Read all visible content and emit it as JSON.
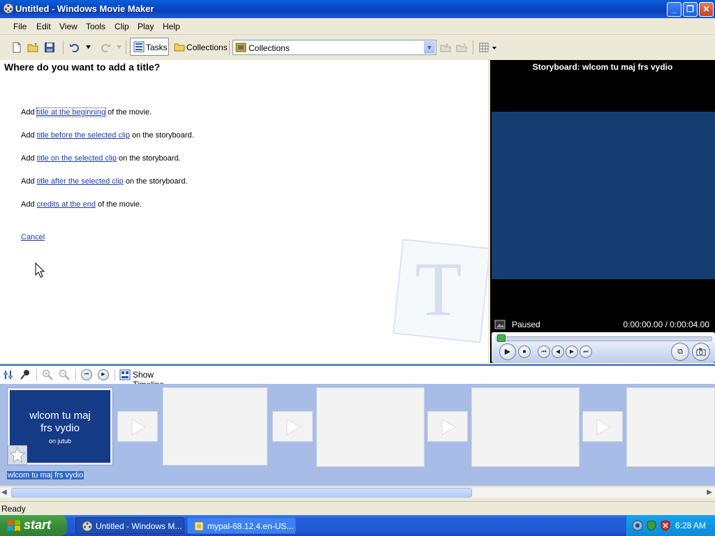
{
  "window": {
    "title": "Untitled - Windows Movie Maker",
    "buttons": {
      "minimize": "_",
      "maximize": "❐",
      "close": "✕"
    }
  },
  "menu": [
    "File",
    "Edit",
    "View",
    "Tools",
    "Clip",
    "Play",
    "Help"
  ],
  "toolbar": {
    "tasks_label": "Tasks",
    "collections_label": "Collections",
    "collections_dropdown_value": "Collections"
  },
  "task_pane": {
    "heading": "Where do you want to add a title?",
    "options": [
      {
        "prefix": "Add ",
        "link": "title at the beginning",
        "suffix": " of the movie."
      },
      {
        "prefix": "Add ",
        "link": "title before the selected clip",
        "suffix": " on the storyboard."
      },
      {
        "prefix": "Add ",
        "link": "title on the selected clip",
        "suffix": " on the storyboard."
      },
      {
        "prefix": "Add ",
        "link": "title after the selected clip",
        "suffix": " on the storyboard."
      },
      {
        "prefix": "Add ",
        "link": "credits at the end",
        "suffix": " of the movie."
      }
    ],
    "cancel": "Cancel",
    "watermark_letter": "T"
  },
  "monitor": {
    "title": "Storyboard: wlcom tu maj frs vydio",
    "status": "Paused",
    "time": "0:00:00.00 / 0:00:04.00",
    "seek_progress": 0.0
  },
  "storyboard_toolbar": {
    "show_timeline": "Show Timeline"
  },
  "storyboard": {
    "clip": {
      "title_line1": "wlcom tu maj",
      "title_line2": "frs vydio",
      "subtitle": "on jutub",
      "label": "wlcom tu maj frs vydio"
    }
  },
  "statusbar": {
    "text": "Ready"
  },
  "taskbar": {
    "start": "start",
    "tasks": [
      {
        "label": "Untitled - Windows M...",
        "active": true
      },
      {
        "label": "mypal-68.12.4.en-US...",
        "active": false
      }
    ],
    "clock": "6:28 AM"
  },
  "colors": {
    "link": "#1a3bb0",
    "monitor_screen": "#163d72",
    "storyboard_bg": "#a7bde8",
    "title_clip_bg": "#153b87"
  }
}
